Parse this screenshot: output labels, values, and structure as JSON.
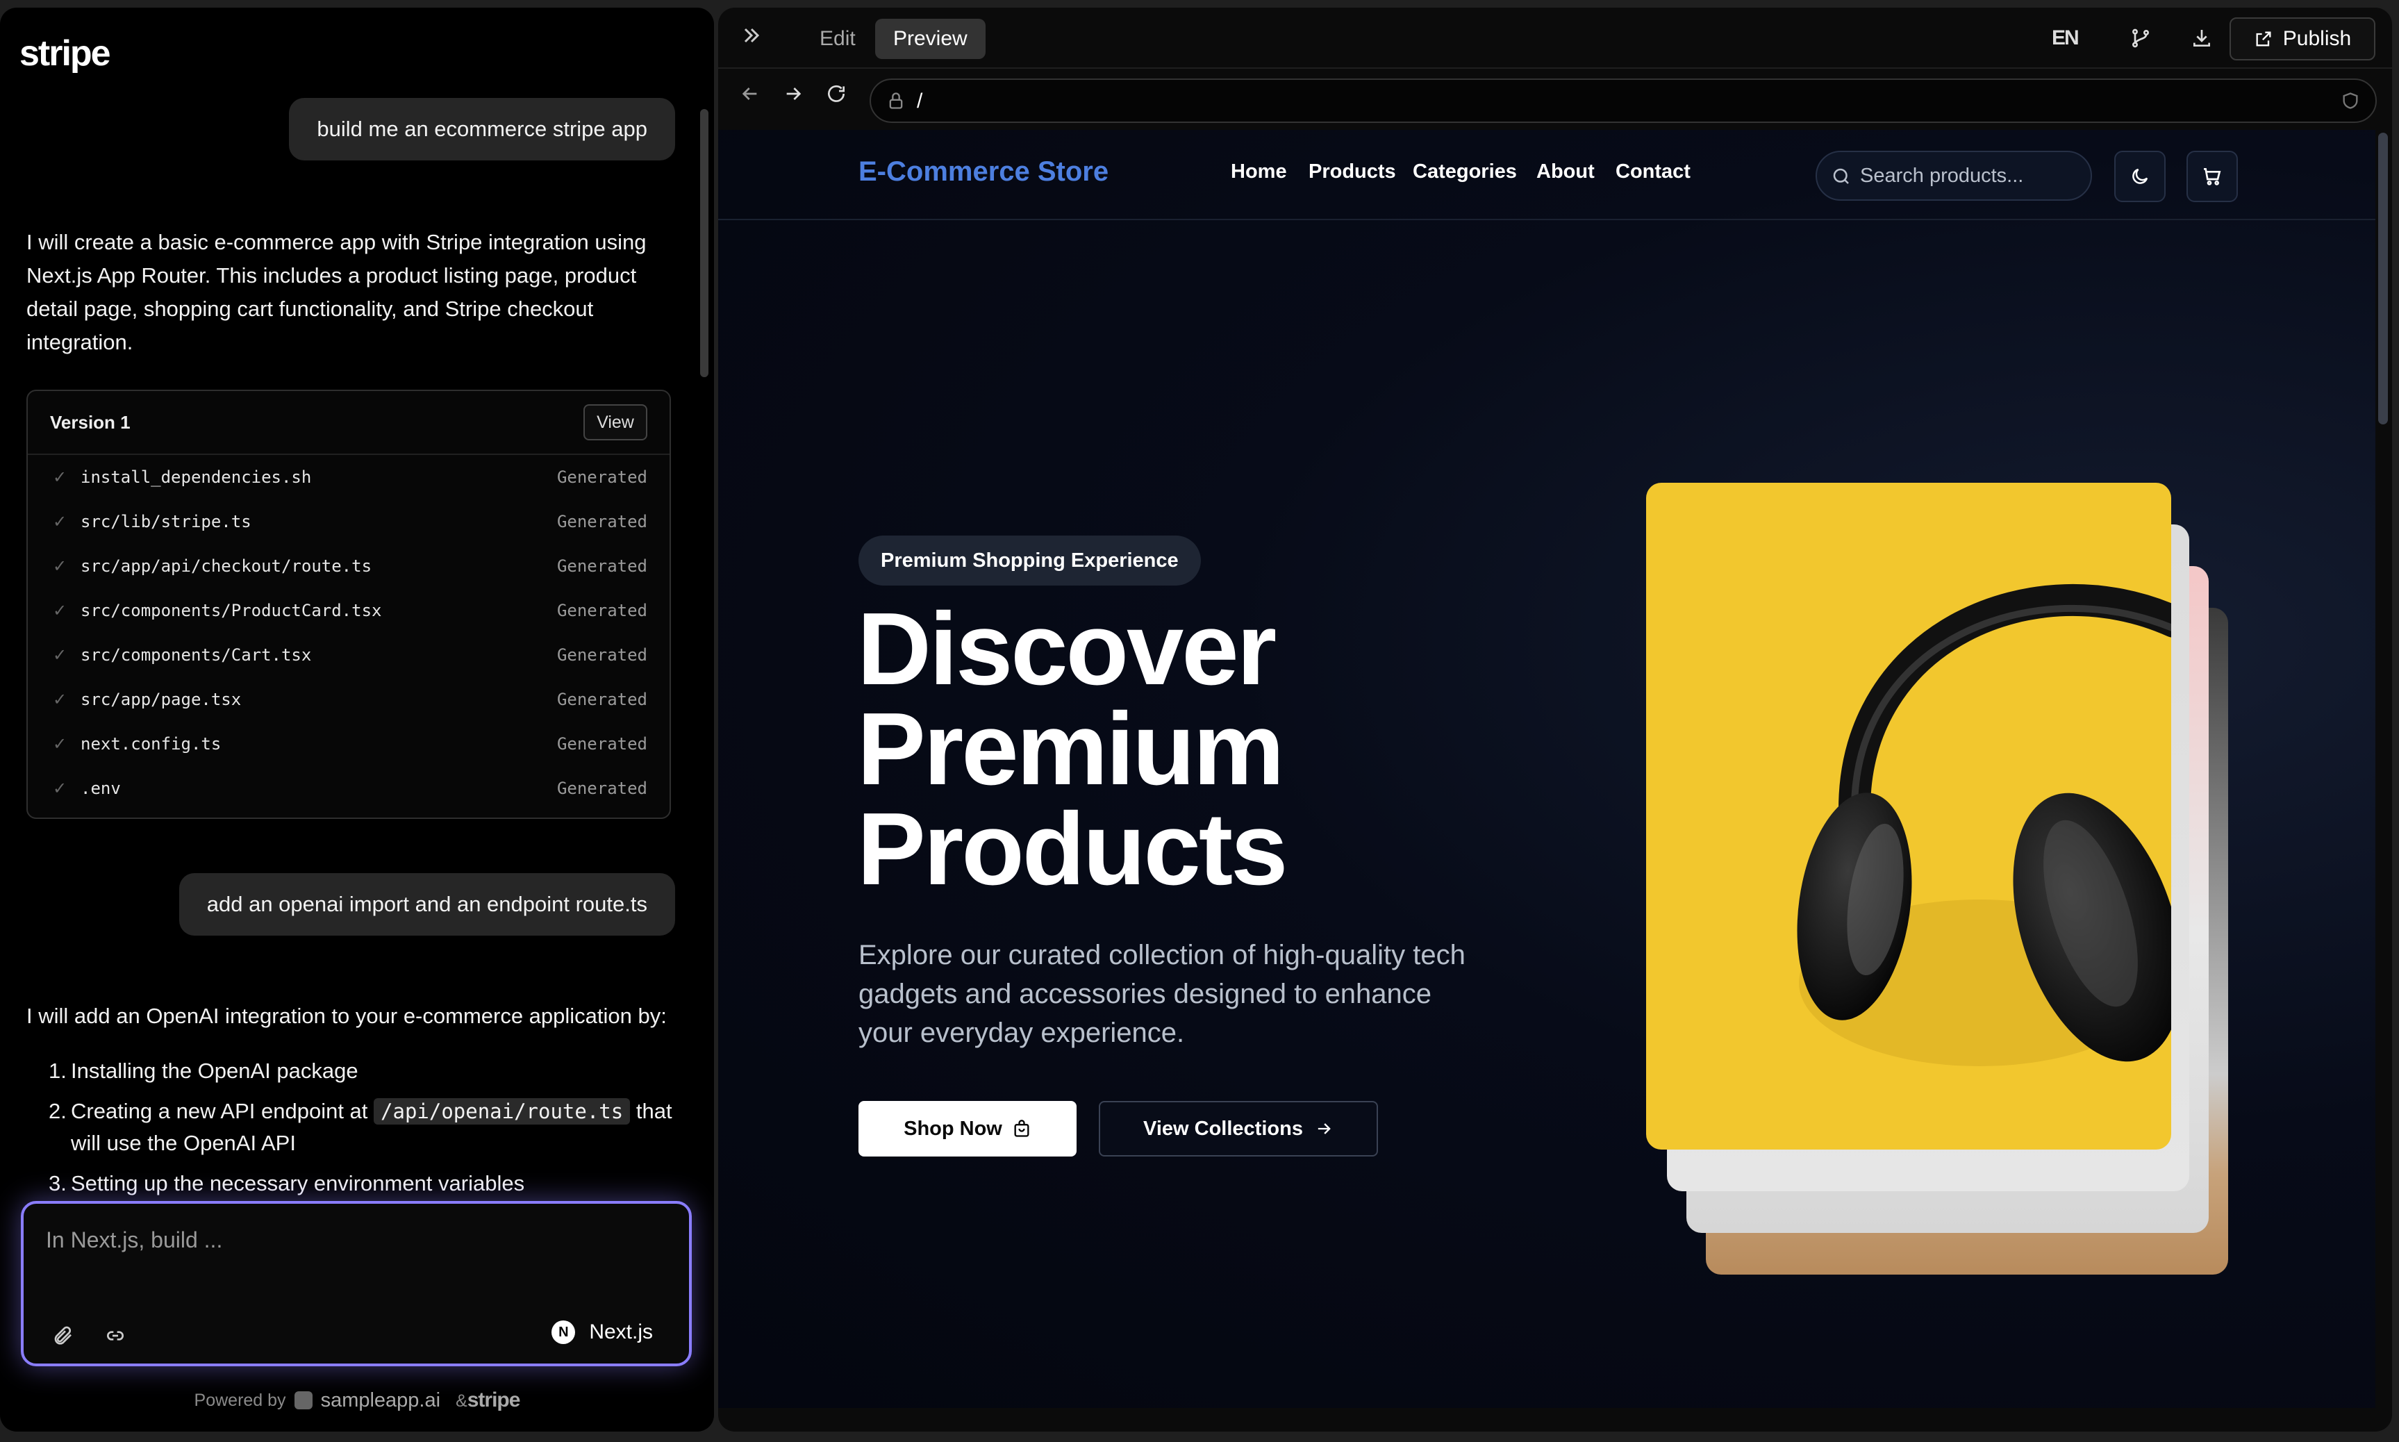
{
  "sidebar": {
    "brand": "stripe",
    "messages": {
      "user_1": "build me an ecommerce stripe app",
      "assistant_1": "I will create a basic e-commerce app with Stripe integration using Next.js App Router. This includes a product listing page, product detail page, shopping cart functionality, and Stripe checkout integration.",
      "user_2": "add an openai import and an endpoint route.ts",
      "assistant_2_intro": "I will add an OpenAI integration to your e-commerce application by:",
      "steps": [
        {
          "num": "1.",
          "text": "Installing the OpenAI package"
        },
        {
          "num": "2.",
          "text_before": "Creating a new API endpoint at",
          "code": "/api/openai/route.ts",
          "text_after": "that will use the OpenAI API"
        },
        {
          "num": "3.",
          "text": "Setting up the necessary environment variables"
        }
      ]
    },
    "version_card": {
      "title": "Version 1",
      "view_label": "View",
      "files": [
        {
          "name": "install_dependencies.sh",
          "status": "Generated"
        },
        {
          "name": "src/lib/stripe.ts",
          "status": "Generated"
        },
        {
          "name": "src/app/api/checkout/route.ts",
          "status": "Generated"
        },
        {
          "name": "src/components/ProductCard.tsx",
          "status": "Generated"
        },
        {
          "name": "src/components/Cart.tsx",
          "status": "Generated"
        },
        {
          "name": "src/app/page.tsx",
          "status": "Generated"
        },
        {
          "name": "next.config.ts",
          "status": "Generated"
        },
        {
          "name": ".env",
          "status": "Generated"
        }
      ]
    },
    "prompt": {
      "placeholder": "In Next.js, build ...",
      "framework": "Next.js",
      "framework_logo": "N"
    },
    "powered_by": {
      "label": "Powered by",
      "product": "sampleapp.ai",
      "partner_prefix": "&",
      "partner": "stripe"
    }
  },
  "toolbar": {
    "tab_edit": "Edit",
    "tab_preview": "Preview",
    "lang_label": "EN",
    "publish_label": "Publish"
  },
  "browser": {
    "url": "/"
  },
  "site": {
    "logo": "E-Commerce Store",
    "nav": [
      "Home",
      "Products",
      "Categories",
      "About",
      "Contact"
    ],
    "search_placeholder": "Search products...",
    "badge": "Premium Shopping Experience",
    "headline": [
      "Discover",
      "Premium",
      "Products"
    ],
    "subtext": "Explore our curated collection of high-quality tech gadgets and accessories designed to enhance your everyday experience.",
    "cta_primary": "Shop Now",
    "cta_secondary": "View Collections"
  },
  "colors": {
    "accent": "#8a7dff",
    "site_logo": "#4d7fe0",
    "hero_image": "#f2c72e"
  }
}
